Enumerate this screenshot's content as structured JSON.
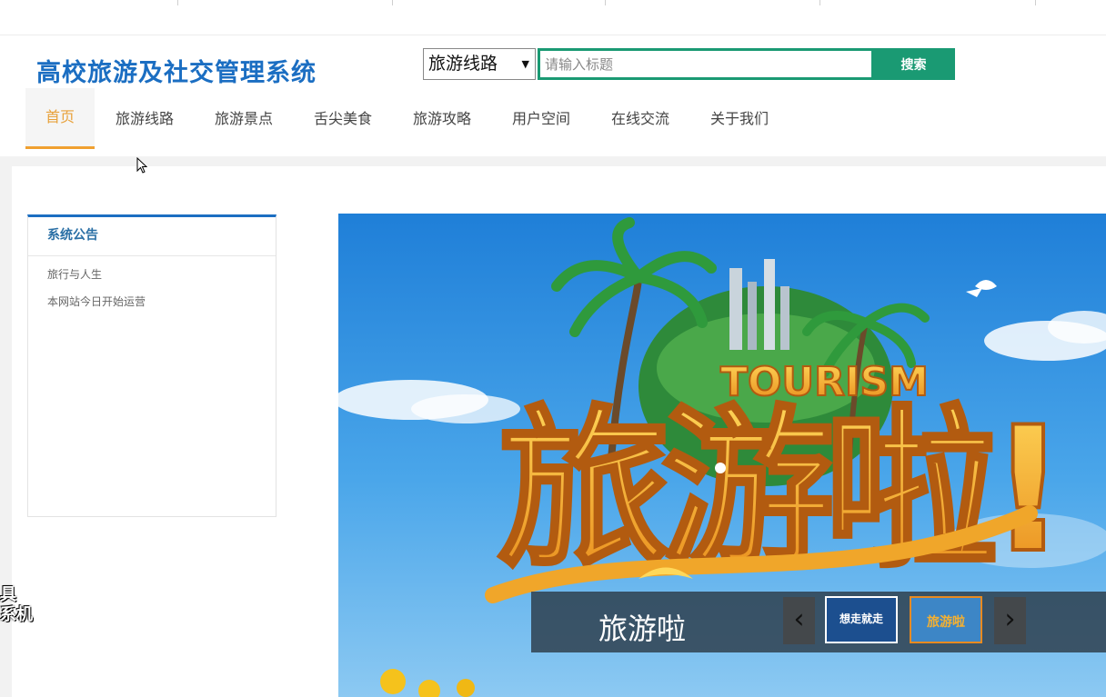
{
  "header": {
    "site_title": "高校旅游及社交管理系统"
  },
  "search": {
    "category": "旅游线路",
    "placeholder": "请输入标题",
    "button_label": "搜索"
  },
  "nav": {
    "items": [
      {
        "label": "首页",
        "active": true
      },
      {
        "label": "旅游线路",
        "active": false
      },
      {
        "label": "旅游景点",
        "active": false
      },
      {
        "label": "舌尖美食",
        "active": false
      },
      {
        "label": "旅游攻略",
        "active": false
      },
      {
        "label": "用户空间",
        "active": false
      },
      {
        "label": "在线交流",
        "active": false
      },
      {
        "label": "关于我们",
        "active": false
      }
    ]
  },
  "notice": {
    "title": "系统公告",
    "items": [
      "旅行与人生",
      "本网站今日开始运营"
    ]
  },
  "banner": {
    "headline": "旅游啦!",
    "subtitle": "TOURISM",
    "caption": "旅游啦",
    "thumbnails": [
      "想走就走",
      "旅游啦"
    ]
  },
  "side_label": "具\n系机",
  "colors": {
    "brand_blue": "#1b6ec2",
    "search_green": "#1a9a73",
    "nav_active": "#e8a13a"
  }
}
